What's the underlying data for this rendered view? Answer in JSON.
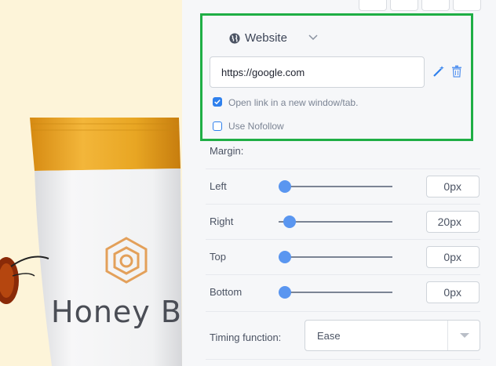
{
  "link": {
    "type_label": "Website",
    "url_value": "https://google.com",
    "open_new_window_label": "Open link in a new window/tab.",
    "open_new_window_checked": true,
    "nofollow_label": "Use Nofollow",
    "nofollow_checked": false
  },
  "margin": {
    "title": "Margin:",
    "rows": [
      {
        "label": "Left",
        "value": "0px",
        "slider_fraction": 0.0
      },
      {
        "label": "Right",
        "value": "20px",
        "slider_fraction": 0.04
      },
      {
        "label": "Top",
        "value": "0px",
        "slider_fraction": 0.0
      },
      {
        "label": "Bottom",
        "value": "0px",
        "slider_fraction": 0.0
      }
    ]
  },
  "timing": {
    "label": "Timing function:",
    "selected": "Ease"
  },
  "colors": {
    "accent": "#2f80ed",
    "highlight_border": "#1fae45",
    "product_cap": "#e8a623",
    "product_logo": "#e3a05a"
  },
  "preview": {
    "product_text": "Honey Biot"
  }
}
